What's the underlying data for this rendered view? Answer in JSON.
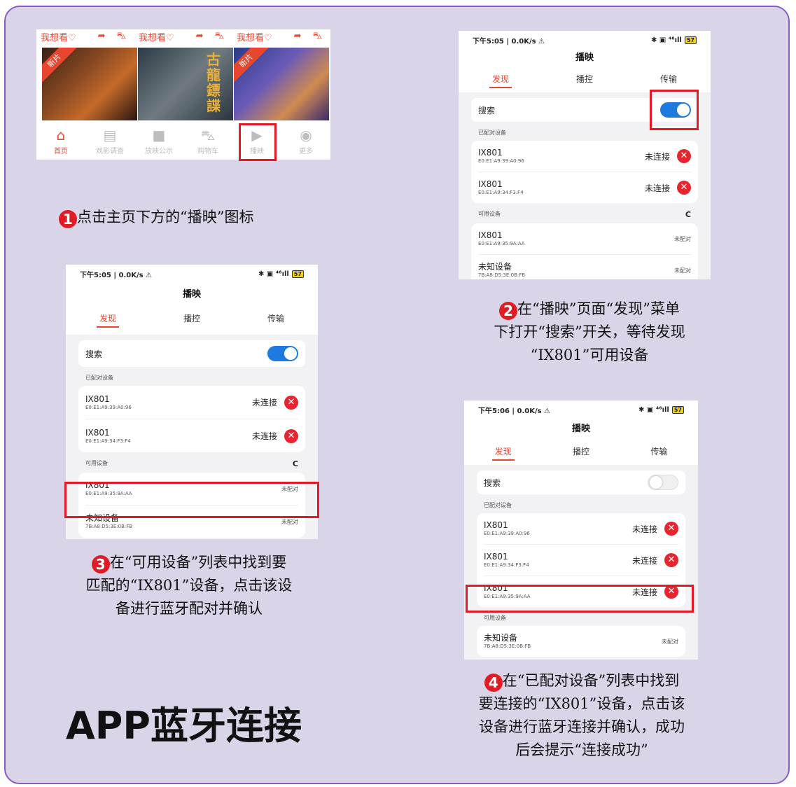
{
  "title": "APP蓝牙连接",
  "home": {
    "want_label": "我想看♡",
    "want_icons": "➦ ⛍",
    "posters": [
      {
        "ribbon": "新片",
        "text": ""
      },
      {
        "ribbon": "",
        "text": "古龍鏢諜"
      },
      {
        "ribbon": "新片",
        "text": ""
      }
    ],
    "nav": [
      {
        "label": "首页",
        "icon": "home-icon",
        "glyph": "⌂"
      },
      {
        "label": "观影调查",
        "icon": "survey-icon",
        "glyph": "▤"
      },
      {
        "label": "放映公示",
        "icon": "video-icon",
        "glyph": "■"
      },
      {
        "label": "购物车",
        "icon": "cart-icon",
        "glyph": "⛍"
      },
      {
        "label": "播映",
        "icon": "play-icon",
        "glyph": "▶"
      },
      {
        "label": "更多",
        "icon": "person-icon",
        "glyph": "◉"
      }
    ]
  },
  "phone": {
    "title": "播映",
    "tabs": [
      "发现",
      "播控",
      "传输"
    ],
    "search_label": "搜索",
    "paired_header": "已配对设备",
    "available_header": "可用设备",
    "refresh": "C",
    "status_not_connected": "未连接",
    "status_unpaired": "未配对",
    "battery": "57",
    "signal": "⁴⁶ıll",
    "bt_icons": "✱ ▣",
    "close_glyph": "✕"
  },
  "screens": {
    "s2": {
      "time": "下午5:05 | 0.0K/s ⚠",
      "paired": [
        {
          "name": "IX801",
          "mac": "E0:E1:A9:39:A0:96"
        },
        {
          "name": "IX801",
          "mac": "E0:E1:A9:34:F3:F4"
        }
      ],
      "available": [
        {
          "name": "IX801",
          "mac": "E0:E1:A9:35:9A:AA"
        },
        {
          "name": "未知设备",
          "mac": "7B:A8:D5:3E:0B:FB"
        }
      ]
    },
    "s3": {
      "time": "下午5:05 | 0.0K/s ⚠",
      "paired": [
        {
          "name": "IX801",
          "mac": "E0:E1:A9:39:A0:96"
        },
        {
          "name": "IX801",
          "mac": "E0:E1:A9:34:F3:F4"
        }
      ],
      "available": [
        {
          "name": "IX801",
          "mac": "E0:E1:A9:35:9A:AA"
        },
        {
          "name": "未知设备",
          "mac": "7B:A8:D5:3E:0B:FB"
        }
      ]
    },
    "s4": {
      "time": "下午5:06 | 0.0K/s ⚠",
      "paired": [
        {
          "name": "IX801",
          "mac": "E0:E1:A9:39:A0:96"
        },
        {
          "name": "IX801",
          "mac": "E0:E1:A9:34:F3:F4"
        },
        {
          "name": "IX801",
          "mac": "E0:E1:A9:35:9A:AA"
        }
      ],
      "available": [
        {
          "name": "未知设备",
          "mac": "7B:A8:D5:3E:0B:FB"
        }
      ]
    }
  },
  "steps": [
    {
      "num": "1",
      "lines": [
        "点击主页下方的“播映”图标"
      ]
    },
    {
      "num": "2",
      "lines": [
        "在“播映”页面“发现”菜单",
        "下打开“搜索”开关，等待发现",
        "“IX801”可用设备"
      ]
    },
    {
      "num": "3",
      "lines": [
        "在“可用设备”列表中找到要",
        "匹配的“IX801”设备，点击该设",
        "备进行蓝牙配对并确认"
      ]
    },
    {
      "num": "4",
      "lines": [
        "在“已配对设备”列表中找到",
        "要连接的“IX801”设备，点击该",
        "设备进行蓝牙连接并确认，成功",
        "后会提示“连接成功”"
      ]
    }
  ]
}
